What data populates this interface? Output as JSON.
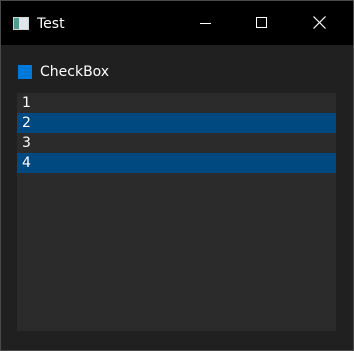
{
  "window": {
    "title": "Test",
    "icon": "app-window-icon",
    "controls": [
      "minimize-icon",
      "maximize-icon",
      "close-icon"
    ]
  },
  "checkbox": {
    "label": "CheckBox",
    "color": "#0078d7"
  },
  "list": {
    "items": [
      {
        "label": "1",
        "selected": false
      },
      {
        "label": "2",
        "selected": true
      },
      {
        "label": "3",
        "selected": false
      },
      {
        "label": "4",
        "selected": true
      }
    ],
    "selection_color": "#004880",
    "background_color": "#2b2b2b"
  },
  "colors": {
    "titlebar": "#000000",
    "window_background": "#202020",
    "text": "#ffffff"
  }
}
